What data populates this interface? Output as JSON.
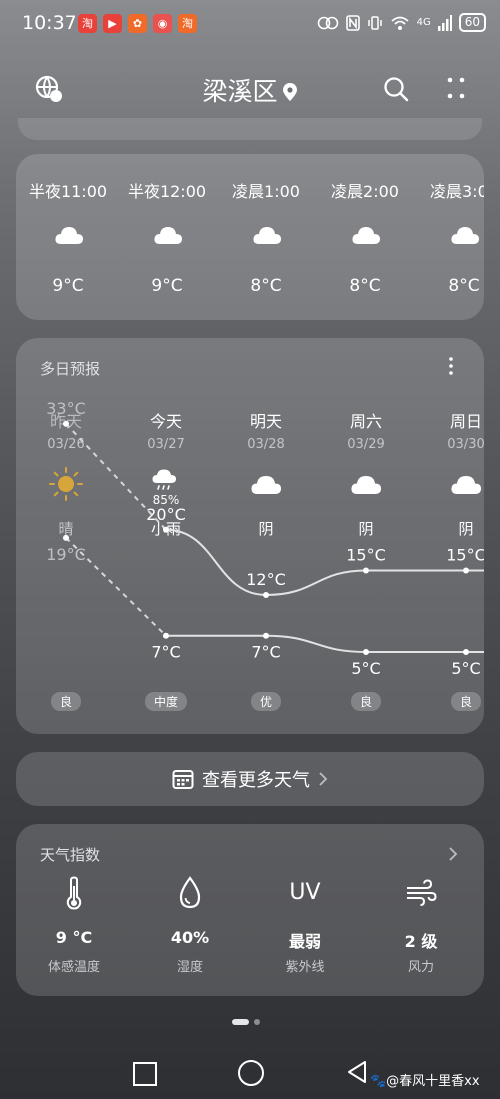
{
  "status": {
    "time": "10:37",
    "apps": [
      "淘",
      "▶",
      "✿",
      "◉",
      "淘"
    ],
    "network": "4G",
    "battery": "60"
  },
  "header": {
    "city": "梁溪区"
  },
  "hourly": [
    {
      "time": "半夜11:00",
      "temp": "9°C",
      "icon": "cloudy-icon"
    },
    {
      "time": "半夜12:00",
      "temp": "9°C",
      "icon": "cloudy-icon"
    },
    {
      "time": "凌晨1:00",
      "temp": "8°C",
      "icon": "cloudy-icon"
    },
    {
      "time": "凌晨2:00",
      "temp": "8°C",
      "icon": "cloudy-icon"
    },
    {
      "time": "凌晨3:00",
      "temp": "8°C",
      "icon": "cloudy-icon"
    }
  ],
  "daily": {
    "title": "多日预报",
    "days": [
      {
        "name": "昨天",
        "date": "03/26",
        "icon": "sunny-icon",
        "pop": "",
        "cond": "晴",
        "aqi": "良",
        "past": true
      },
      {
        "name": "今天",
        "date": "03/27",
        "icon": "rain-icon",
        "pop": "85%",
        "cond": "小雨",
        "aqi": "中度",
        "past": false
      },
      {
        "name": "明天",
        "date": "03/28",
        "icon": "cloudy-icon",
        "pop": "",
        "cond": "阴",
        "aqi": "优",
        "past": false
      },
      {
        "name": "周六",
        "date": "03/29",
        "icon": "cloudy-icon",
        "pop": "",
        "cond": "阴",
        "aqi": "良",
        "past": false
      },
      {
        "name": "周日",
        "date": "03/30",
        "icon": "cloudy-icon",
        "pop": "",
        "cond": "阴",
        "aqi": "良",
        "past": false
      }
    ]
  },
  "chart_data": {
    "type": "line",
    "categories": [
      "昨天",
      "今天",
      "明天",
      "周六",
      "周日"
    ],
    "series": [
      {
        "values": [
          33,
          20,
          12,
          15,
          15
        ]
      },
      {
        "values": [
          19,
          7,
          7,
          5,
          5
        ]
      }
    ],
    "labels_high": [
      "33°C",
      "20°C",
      "12°C",
      "15°C",
      "15°C"
    ],
    "labels_low": [
      "19°C",
      "7°C",
      "7°C",
      "5°C",
      "5°C"
    ]
  },
  "more_weather": {
    "label": "查看更多天气"
  },
  "indices": {
    "title": "天气指数",
    "items": [
      {
        "icon": "thermometer-icon",
        "value": "9 °C",
        "label": "体感温度"
      },
      {
        "icon": "humidity-drop-icon",
        "value": "40%",
        "label": "湿度"
      },
      {
        "icon": "uv-icon",
        "value": "最弱",
        "label": "紫外线",
        "icon_text": "UV"
      },
      {
        "icon": "wind-icon",
        "value": "2 级",
        "label": "风力"
      }
    ]
  },
  "watermark": "🐾@春风十里香xx"
}
